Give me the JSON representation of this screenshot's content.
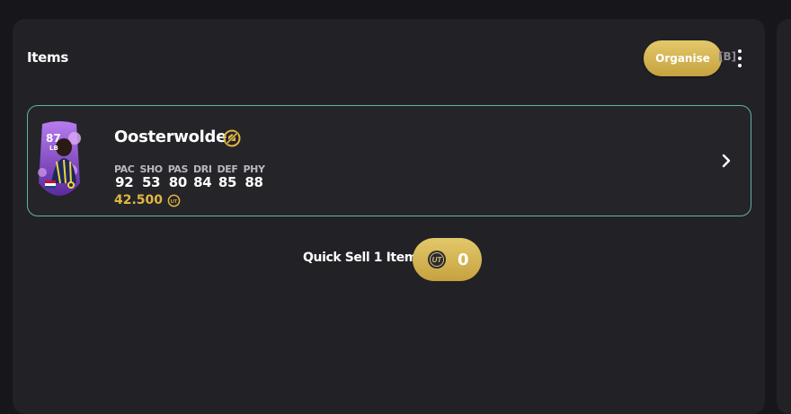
{
  "panel": {
    "title": "Items",
    "organise_label": "Organise",
    "hotkey": "[B]",
    "menu_icon": "kebab-menu-icon"
  },
  "item": {
    "rating": "87",
    "position": "LB",
    "name": "Oosterwolde",
    "badge_icon": "untradeable-icon",
    "stats": [
      {
        "label": "PAC",
        "value": "92"
      },
      {
        "label": "SHO",
        "value": "53"
      },
      {
        "label": "PAS",
        "value": "80"
      },
      {
        "label": "DRI",
        "value": "84"
      },
      {
        "label": "DEF",
        "value": "85"
      },
      {
        "label": "PHY",
        "value": "88"
      }
    ],
    "price": "42.500",
    "price_icon": "coin-icon"
  },
  "quick_sell": {
    "label": "Quick Sell 1 Item",
    "value": "0",
    "icon": "coin-icon"
  },
  "colors": {
    "background": "#17161b",
    "panel": "#222126",
    "gold": "#e0b741",
    "row_border": "#5fb3aa",
    "card_purple": "#8a4fd0"
  }
}
